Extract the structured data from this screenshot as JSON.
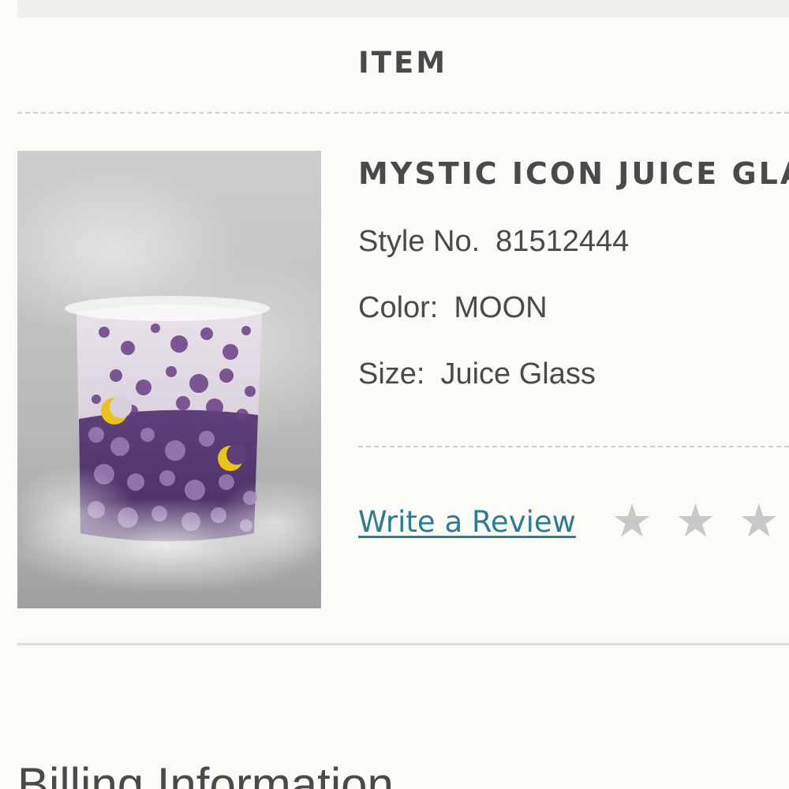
{
  "table": {
    "column_header": "ITEM"
  },
  "product": {
    "title": "MYSTIC ICON JUICE GLAS",
    "image_alt": "Mystic Icon Juice Glass",
    "style_label": "Style No.",
    "style_value": "81512444",
    "color_label": "Color:",
    "color_value": "MOON",
    "size_label": "Size:",
    "size_value": "Juice Glass"
  },
  "review": {
    "link_label": "Write a Review",
    "stars": [
      "★",
      "★",
      "★",
      "★"
    ],
    "star_color": "#c8c8c8",
    "link_color": "#2e7d8f"
  },
  "billing": {
    "heading": "Billing Information"
  }
}
